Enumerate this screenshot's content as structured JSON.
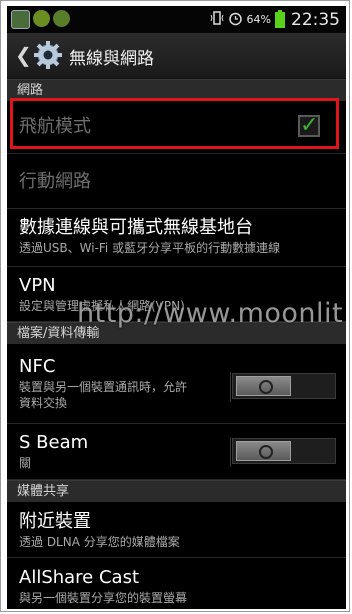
{
  "status_bar": {
    "battery_percent": "64%",
    "time": "22:35"
  },
  "action_bar": {
    "title": "無線與網路"
  },
  "sections": {
    "network": "網路",
    "file_transfer": "檔案/資料傳輸",
    "media_share": "媒體共享"
  },
  "items": {
    "airplane": {
      "title": "飛航模式",
      "checked": true
    },
    "mobile": {
      "title": "行動網路"
    },
    "tethering": {
      "title": "數據連線與可攜式無線基地台",
      "sub": "透過USB、Wi-Fi 或藍牙分享平板的行動數據連線"
    },
    "vpn": {
      "title": "VPN",
      "sub": "設定與管理虛擬私人網路(VPN)"
    },
    "nfc": {
      "title": "NFC",
      "sub1": "裝置與另一個裝置通訊時，允許",
      "sub2": "資料交換",
      "enabled": false
    },
    "sbeam": {
      "title": "S Beam",
      "sub": "關",
      "enabled": false
    },
    "nearby": {
      "title": "附近裝置",
      "sub": "透過 DLNA 分享您的媒體檔案"
    },
    "allshare": {
      "title": "AllShare Cast",
      "sub": "與另一個裝置分享您的裝置螢幕"
    }
  },
  "watermark": "http://www.moonlit.tw",
  "colors": {
    "highlight_border": "#e0141b",
    "check_green": "#3fae3a",
    "battery_green": "#59d11b"
  }
}
